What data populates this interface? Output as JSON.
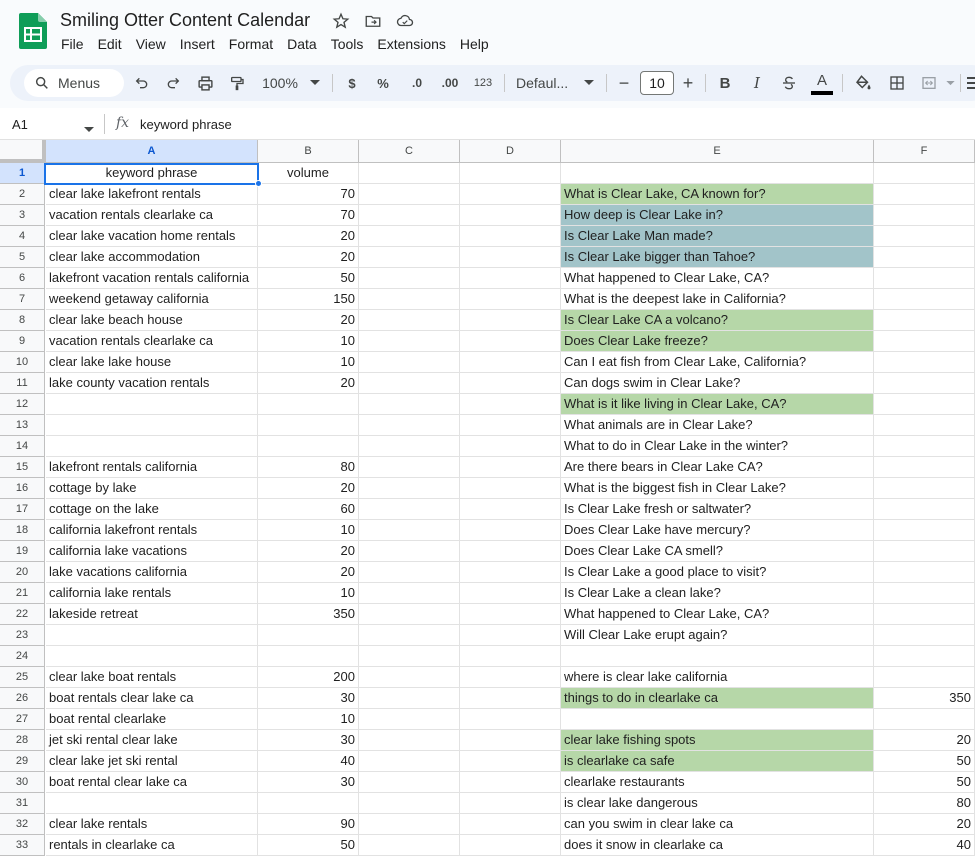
{
  "app": {
    "title": "Smiling Otter Content Calendar",
    "menu": [
      "File",
      "Edit",
      "View",
      "Insert",
      "Format",
      "Data",
      "Tools",
      "Extensions",
      "Help"
    ]
  },
  "toolbar": {
    "search_label": "Menus",
    "zoom": "100%",
    "currency": "$",
    "percent": "%",
    "dec_decrease": ".0",
    "dec_increase": ".00",
    "number_format": "123",
    "font": "Defaul...",
    "font_size": "10",
    "minus": "−",
    "plus": "+",
    "bold": "B",
    "italic": "I",
    "text_color_glyph": "A"
  },
  "formula_bar": {
    "cell_ref": "A1",
    "fx": "fx",
    "content": "keyword phrase"
  },
  "columns": [
    "A",
    "B",
    "C",
    "D",
    "E",
    "F"
  ],
  "rows": [
    {
      "n": "1",
      "a": "keyword phrase",
      "b": "volume",
      "e": "",
      "f": "",
      "ec": ""
    },
    {
      "n": "2",
      "a": "clear lake lakefront rentals",
      "b": "70",
      "e": "What is Clear Lake, CA known for?",
      "f": "",
      "ec": "green"
    },
    {
      "n": "3",
      "a": "vacation rentals clearlake ca",
      "b": "70",
      "e": "How deep is Clear Lake in?",
      "f": "",
      "ec": "teal"
    },
    {
      "n": "4",
      "a": "clear lake vacation home rentals",
      "b": "20",
      "e": "Is Clear Lake Man made?",
      "f": "",
      "ec": "teal"
    },
    {
      "n": "5",
      "a": "clear lake accommodation",
      "b": "20",
      "e": "Is Clear Lake bigger than Tahoe?",
      "f": "",
      "ec": "teal"
    },
    {
      "n": "6",
      "a": "lakefront vacation rentals california",
      "b": "50",
      "e": "What happened to Clear Lake, CA?",
      "f": "",
      "ec": ""
    },
    {
      "n": "7",
      "a": "weekend getaway california",
      "b": "150",
      "e": "What is the deepest lake in California?",
      "f": "",
      "ec": ""
    },
    {
      "n": "8",
      "a": "clear lake beach house",
      "b": "20",
      "e": "Is Clear Lake CA a volcano?",
      "f": "",
      "ec": "green"
    },
    {
      "n": "9",
      "a": "vacation rentals clearlake ca",
      "b": "10",
      "e": "Does Clear Lake freeze?",
      "f": "",
      "ec": "green"
    },
    {
      "n": "10",
      "a": "clear lake lake house",
      "b": "10",
      "e": "Can I eat fish from Clear Lake, California?",
      "f": "",
      "ec": ""
    },
    {
      "n": "11",
      "a": "lake county vacation rentals",
      "b": "20",
      "e": "Can dogs swim in Clear Lake?",
      "f": "",
      "ec": ""
    },
    {
      "n": "12",
      "a": "",
      "b": "",
      "e": "What is it like living in Clear Lake, CA?",
      "f": "",
      "ec": "green"
    },
    {
      "n": "13",
      "a": "",
      "b": "",
      "e": "What animals are in Clear Lake?",
      "f": "",
      "ec": ""
    },
    {
      "n": "14",
      "a": "",
      "b": "",
      "e": "What to do in Clear Lake in the winter?",
      "f": "",
      "ec": ""
    },
    {
      "n": "15",
      "a": "lakefront rentals california",
      "b": "80",
      "e": "Are there bears in Clear Lake CA?",
      "f": "",
      "ec": ""
    },
    {
      "n": "16",
      "a": "cottage by lake",
      "b": "20",
      "e": "What is the biggest fish in Clear Lake?",
      "f": "",
      "ec": ""
    },
    {
      "n": "17",
      "a": "cottage on the lake",
      "b": "60",
      "e": "Is Clear Lake fresh or saltwater?",
      "f": "",
      "ec": ""
    },
    {
      "n": "18",
      "a": "california lakefront rentals",
      "b": "10",
      "e": "Does Clear Lake have mercury?",
      "f": "",
      "ec": ""
    },
    {
      "n": "19",
      "a": "california lake vacations",
      "b": "20",
      "e": "Does Clear Lake CA smell?",
      "f": "",
      "ec": ""
    },
    {
      "n": "20",
      "a": "lake vacations california",
      "b": "20",
      "e": "Is Clear Lake a good place to visit?",
      "f": "",
      "ec": ""
    },
    {
      "n": "21",
      "a": "california lake rentals",
      "b": "10",
      "e": "Is Clear Lake a clean lake?",
      "f": "",
      "ec": ""
    },
    {
      "n": "22",
      "a": "lakeside retreat",
      "b": "350",
      "e": "What happened to Clear Lake, CA?",
      "f": "",
      "ec": ""
    },
    {
      "n": "23",
      "a": "",
      "b": "",
      "e": "Will Clear Lake erupt again?",
      "f": "",
      "ec": ""
    },
    {
      "n": "24",
      "a": "",
      "b": "",
      "e": "",
      "f": "",
      "ec": ""
    },
    {
      "n": "25",
      "a": "clear lake boat rentals",
      "b": "200",
      "e": "where is clear lake california",
      "f": "",
      "ec": ""
    },
    {
      "n": "26",
      "a": "boat rentals clear lake ca",
      "b": "30",
      "e": "things to do in clearlake ca",
      "f": "350",
      "ec": "green"
    },
    {
      "n": "27",
      "a": "boat rental clearlake",
      "b": "10",
      "e": "",
      "f": "",
      "ec": ""
    },
    {
      "n": "28",
      "a": "jet ski rental clear lake",
      "b": "30",
      "e": "clear lake fishing spots",
      "f": "20",
      "ec": "green"
    },
    {
      "n": "29",
      "a": "clear lake jet ski rental",
      "b": "40",
      "e": "is clearlake ca safe",
      "f": "50",
      "ec": "green"
    },
    {
      "n": "30",
      "a": "boat rental clear lake ca",
      "b": "30",
      "e": "clearlake restaurants",
      "f": "50",
      "ec": ""
    },
    {
      "n": "31",
      "a": "",
      "b": "",
      "e": "is clear lake dangerous",
      "f": "80",
      "ec": ""
    },
    {
      "n": "32",
      "a": "clear lake rentals",
      "b": "90",
      "e": "can you swim in clear lake ca",
      "f": "20",
      "ec": ""
    },
    {
      "n": "33",
      "a": "rentals in clearlake ca",
      "b": "50",
      "e": "does it snow in clearlake ca",
      "f": "40",
      "ec": ""
    }
  ]
}
